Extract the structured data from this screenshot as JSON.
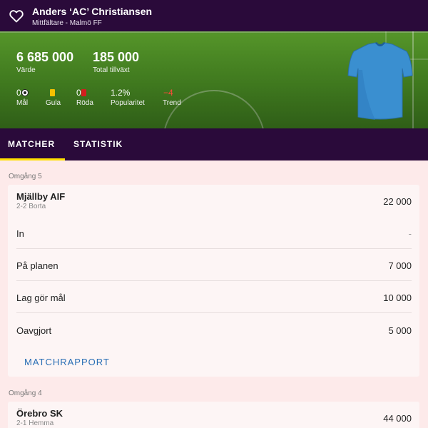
{
  "header": {
    "player_name": "Anders ‘AC’ Christiansen",
    "player_subtitle": "Mittfältare - Malmö FF",
    "favorite_icon": "heart-outline-icon"
  },
  "hero": {
    "value": "6 685 000",
    "value_label": "Värde",
    "growth": "185 000",
    "growth_label": "Total tillväxt",
    "goals": "0",
    "goals_label": "Mål",
    "yellow_label": "Gula",
    "red": "0",
    "red_label": "Röda",
    "popularity": "1.2%",
    "popularity_label": "Popularitet",
    "trend": "−4",
    "trend_label": "Trend",
    "shirt_color": "#3a8fd0",
    "trend_color": "#ff4a3a"
  },
  "tabs": {
    "matches": "MATCHER",
    "stats": "STATISTIK"
  },
  "rounds": [
    {
      "label": "Omgång 5",
      "team": "Mjällby AIF",
      "result": "2-2 Borta",
      "points": "22 000",
      "rows": [
        {
          "label": "In",
          "value": "-"
        },
        {
          "label": "På planen",
          "value": "7 000"
        },
        {
          "label": "Lag gör mål",
          "value": "10 000"
        },
        {
          "label": "Oavgjort",
          "value": "5 000"
        }
      ],
      "report": "MATCHRAPPORT"
    },
    {
      "label": "Omgång 4",
      "team": "Örebro SK",
      "result": "2-1 Hemma",
      "points": "44 000"
    }
  ],
  "colors": {
    "topbar": "#2a0a3a",
    "tab_indicator": "#ffe000",
    "link": "#2a6fb5",
    "background": "#fdeaea"
  }
}
